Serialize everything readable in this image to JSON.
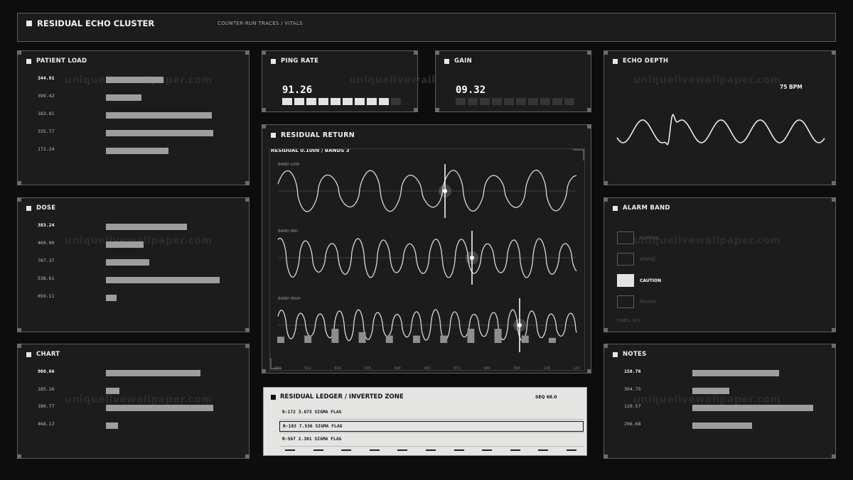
{
  "header": {
    "title": "RESIDUAL ECHO CLUSTER",
    "subtitle": "COUNTER-RUN TRACES / VITALS"
  },
  "watermark": "uniquelivewallpaper.com",
  "patient_load": {
    "title": "PATIENT LOAD",
    "rows": [
      {
        "value": "344.91",
        "fill": 0.45
      },
      {
        "value": "399.42",
        "fill": 0.28
      },
      {
        "value": "183.81",
        "fill": 0.83
      },
      {
        "value": "335.77",
        "fill": 0.84
      },
      {
        "value": "172.24",
        "fill": 0.49
      }
    ]
  },
  "dose": {
    "title": "DOSE",
    "rows": [
      {
        "value": "383.24",
        "fill": 0.67
      },
      {
        "value": "460.90",
        "fill": 0.31
      },
      {
        "value": "707.37",
        "fill": 0.36
      },
      {
        "value": "538.61",
        "fill": 0.94
      },
      {
        "value": "659.11",
        "fill": 0.09
      }
    ]
  },
  "chart_panel": {
    "title": "CHART",
    "rows": [
      {
        "value": "908.66",
        "fill": 0.78
      },
      {
        "value": "185.26",
        "fill": 0.11
      },
      {
        "value": "180.77",
        "fill": 0.89
      },
      {
        "value": "468.12",
        "fill": 0.1
      }
    ]
  },
  "ping_rate": {
    "title": "PING RATE",
    "value": "91.26",
    "cells_on": 9,
    "cells_total": 10
  },
  "gain": {
    "title": "GAIN",
    "value": "09.32",
    "cells_on": 0,
    "cells_total": 10
  },
  "echo_depth": {
    "title": "ECHO DEPTH",
    "bpm": "75 BPM"
  },
  "residual_return": {
    "title": "RESIDUAL RETURN",
    "info": "RESIDUAL 0.1008 / BANDS 3",
    "bands": [
      "BAND LOW",
      "BAND MID",
      "BAND HIGH"
    ],
    "x_ticks": [
      "900",
      "912",
      "924",
      "936",
      "948",
      "960",
      "972",
      "984",
      "996",
      "108",
      "120"
    ],
    "histogram": [
      0.3,
      0.0,
      0.4,
      0.0,
      1.0,
      0.0,
      0.7,
      0.0,
      0.4,
      0.0,
      0.4,
      0.0,
      0.4,
      0.0,
      1.0,
      0.0,
      1.0,
      0.0,
      0.4,
      0.0,
      0.2
    ]
  },
  "alarm_band": {
    "title": "ALARM BAND",
    "items": [
      {
        "label": "NOMINAL",
        "active": false
      },
      {
        "label": "ADVISE",
        "active": false
      },
      {
        "label": "CAUTION",
        "active": true
      },
      {
        "label": "REVIEW",
        "active": false
      }
    ],
    "dwell": "DWELL 34.0"
  },
  "notes": {
    "title": "NOTES",
    "rows": [
      {
        "value": "158.76",
        "fill": 0.71
      },
      {
        "value": "394.75",
        "fill": 0.3
      },
      {
        "value": "110.57",
        "fill": 0.99
      },
      {
        "value": "296.68",
        "fill": 0.49
      }
    ]
  },
  "ledger": {
    "title": "RESIDUAL LEDGER / INVERTED ZONE",
    "seq": "SEQ 68.0",
    "rows": [
      {
        "text": "R-172  3.673 SIGMA  FLAG",
        "selected": false
      },
      {
        "text": "R-183  7.536 SIGMA  FLAG",
        "selected": true
      },
      {
        "text": "R-567  2.301 SIGMA  FLAG",
        "selected": false
      }
    ]
  },
  "colors": {
    "background": "#0c0d0c",
    "panel": "#1b1c1b",
    "border": "#5c5e5c",
    "bar": "#9e9e9e",
    "trace": "#d8d8d8",
    "ledger_bg": "#e4e5e3"
  }
}
